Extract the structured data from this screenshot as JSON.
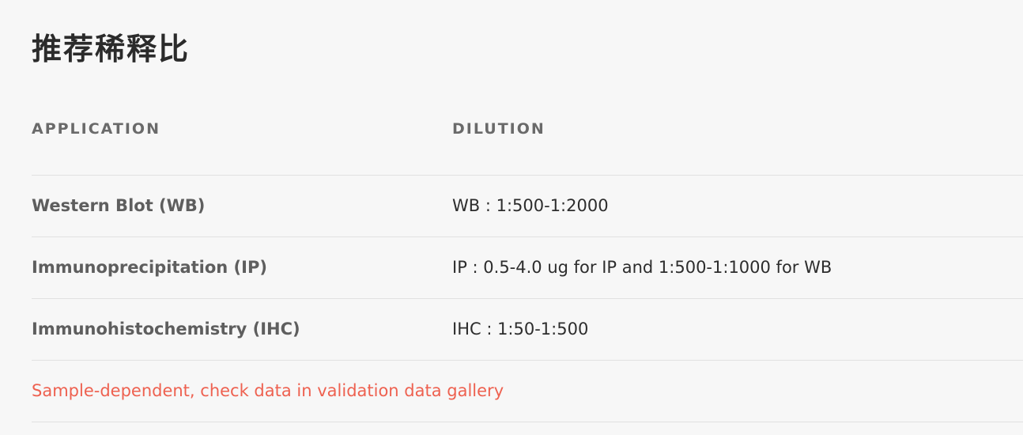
{
  "section": {
    "title": "推荐稀释比"
  },
  "table": {
    "headers": {
      "application": "APPLICATION",
      "dilution": "DILUTION"
    },
    "rows": [
      {
        "application": "Western Blot (WB)",
        "dilution": "WB : 1:500-1:2000"
      },
      {
        "application": "Immunoprecipitation (IP)",
        "dilution": "IP : 0.5-4.0 ug for IP and 1:500-1:1000 for WB"
      },
      {
        "application": "Immunohistochemistry (IHC)",
        "dilution": "IHC : 1:50-1:500"
      }
    ],
    "note": "Sample-dependent, check data in validation data gallery"
  },
  "colors": {
    "background": "#f7f7f7",
    "note_accent": "#ee6150"
  }
}
